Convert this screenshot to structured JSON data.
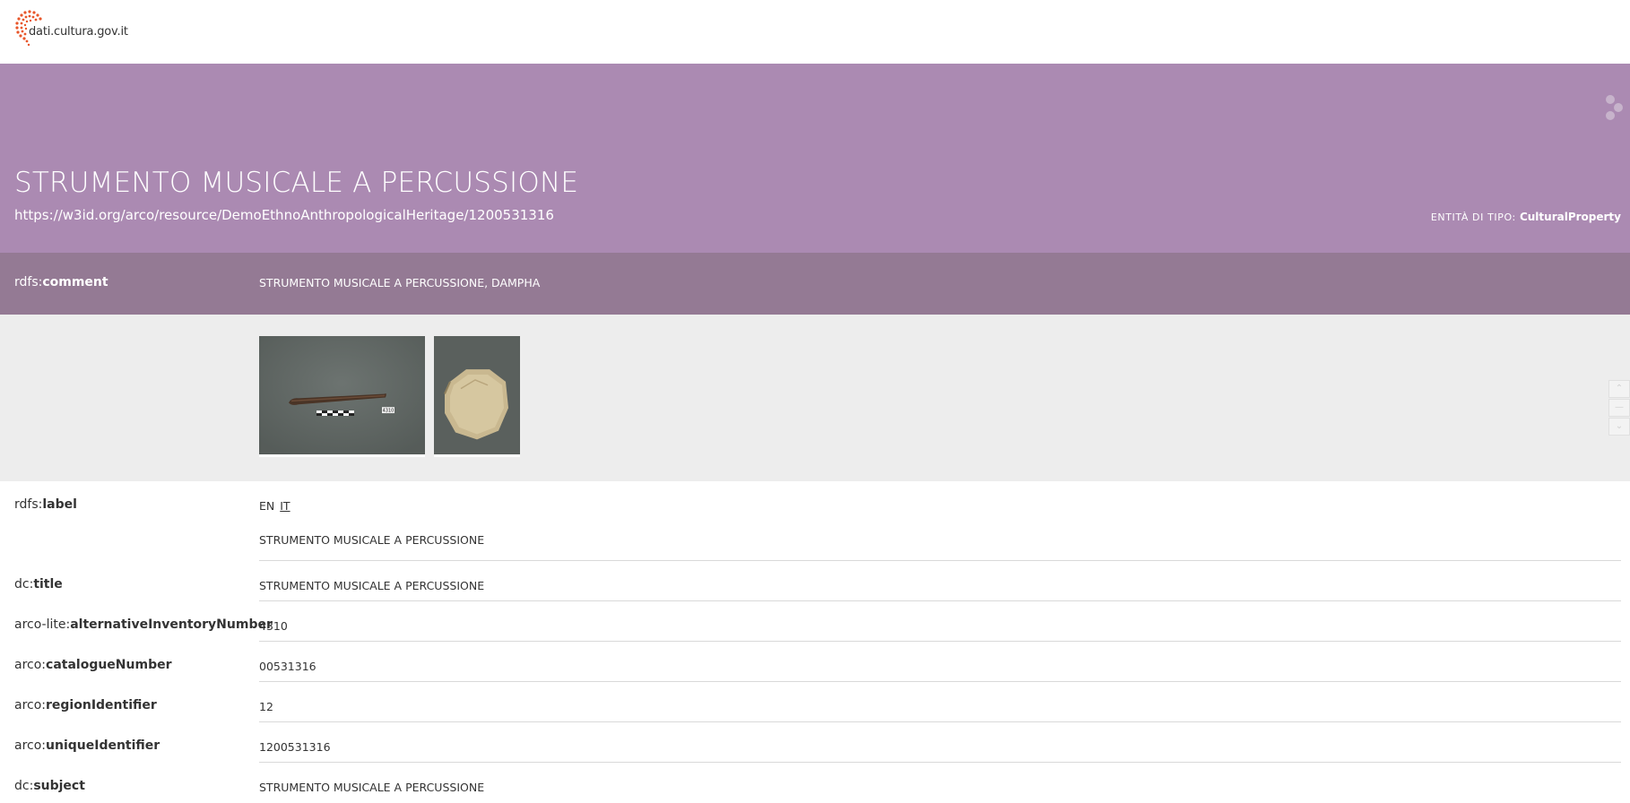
{
  "site": {
    "logo_text": "dati.cultura.gov.it"
  },
  "hero": {
    "title": "STRUMENTO MUSICALE A PERCUSSIONE",
    "uri": "https://w3id.org/arco/resource/DemoEthnoAnthropologicalHeritage/1200531316",
    "type_prefix": "ENTITÀ DI TIPO:",
    "type_value": "CulturalProperty",
    "share_icon": "share-icon"
  },
  "comment": {
    "ns": "rdfs:",
    "prop": "comment",
    "value": "STRUMENTO MUSICALE A PERCUSSIONE, DAMPHA"
  },
  "gallery": {
    "images": [
      "drumstick-photo",
      "frame-drum-photo"
    ],
    "scale_tag": "4310"
  },
  "properties": [
    {
      "ns": "rdfs:",
      "prop": "label",
      "langs": [
        "EN",
        "IT"
      ],
      "value": "STRUMENTO MUSICALE A PERCUSSIONE"
    },
    {
      "ns": "dc:",
      "prop": "title",
      "value": "STRUMENTO MUSICALE A PERCUSSIONE"
    },
    {
      "ns": "arco-lite:",
      "prop": "alternativeInventoryNumber",
      "value": "4310"
    },
    {
      "ns": "arco:",
      "prop": "catalogueNumber",
      "value": "00531316"
    },
    {
      "ns": "arco:",
      "prop": "regionIdentifier",
      "value": "12"
    },
    {
      "ns": "arco:",
      "prop": "uniqueIdentifier",
      "value": "1200531316"
    },
    {
      "ns": "dc:",
      "prop": "subject",
      "value": "STRUMENTO MUSICALE A PERCUSSIONE"
    }
  ],
  "colors": {
    "hero_bg": "#ab8ab2",
    "comment_bg": "#947a94",
    "gallery_bg": "#ededed",
    "logo_accent": "#e8562a"
  }
}
